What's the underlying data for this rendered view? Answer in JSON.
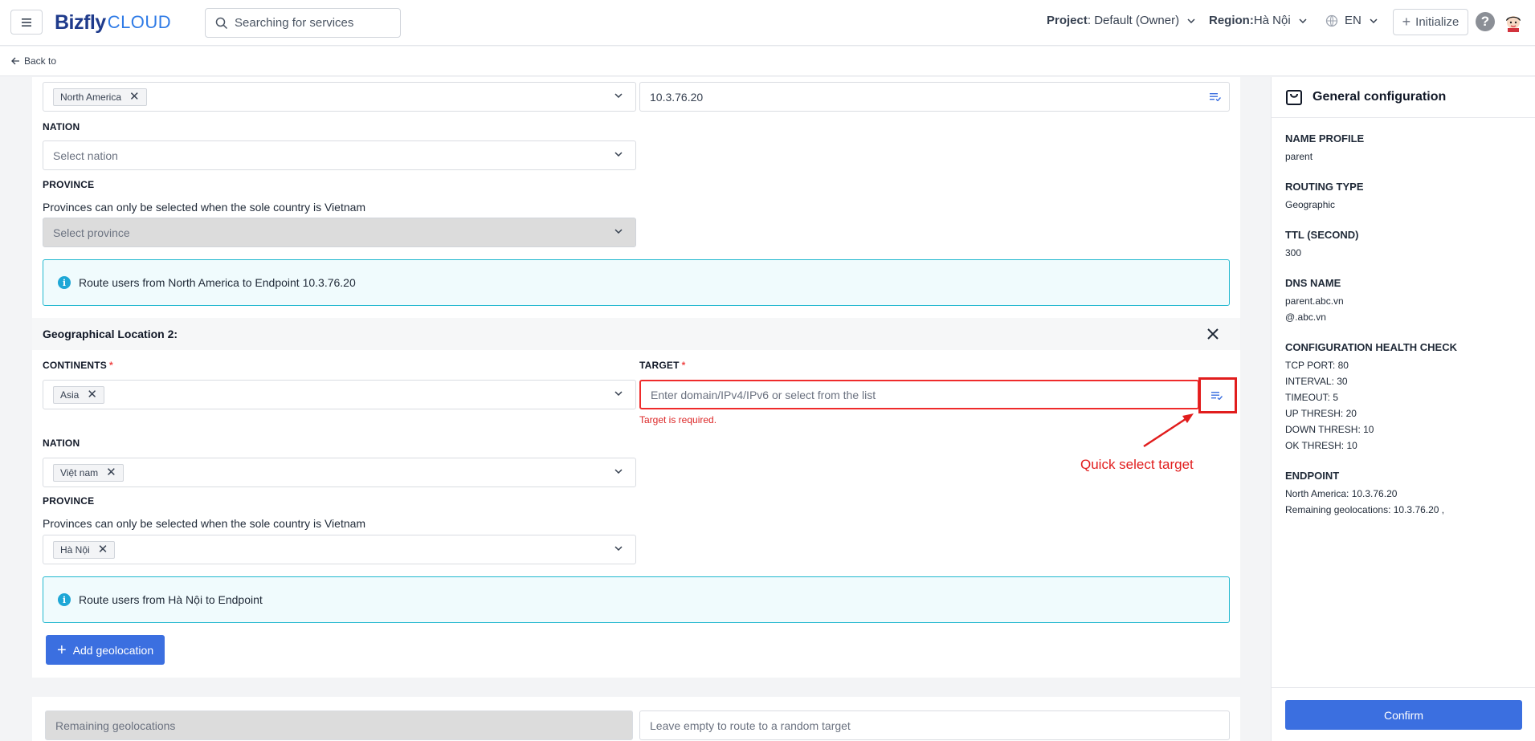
{
  "header": {
    "logo_main": "Bizfly",
    "logo_sub": "CLOUD",
    "search_placeholder": "Searching for services",
    "project_label": "Project",
    "project_value": " : Default (Owner)",
    "region_label": "Region:",
    "region_value": " Hà Nội",
    "language": "EN",
    "initialize_label": "Initialize",
    "help_label": "?"
  },
  "back_label": "Back to",
  "location1": {
    "continent_tag": "North America",
    "target_value": "10.3.76.20",
    "nation_label": "NATION",
    "nation_placeholder": "Select nation",
    "province_label": "PROVINCE",
    "province_help": "Provinces can only be selected when the sole country is Vietnam",
    "province_placeholder": "Select province",
    "info": "Route users from North America to Endpoint 10.3.76.20"
  },
  "location2": {
    "title": "Geographical Location 2:",
    "continents_label": "CONTINENTS",
    "required_mark": "*",
    "continent_tag": "Asia",
    "target_label": "TARGET",
    "target_placeholder": "Enter domain/IPv4/IPv6 or select from the list",
    "target_error": "Target is required.",
    "nation_label": "NATION",
    "nation_tag": "Việt nam",
    "province_label": "PROVINCE",
    "province_help": "Provinces can only be selected when the sole country is Vietnam",
    "province_tag": "Hà Nội",
    "info": "Route users from Hà Nội to Endpoint"
  },
  "annotation": "Quick select target",
  "add_geolocation_label": "Add geolocation",
  "remaining": {
    "label": "Remaining geolocations",
    "target_placeholder": "Leave empty to route to a random target"
  },
  "panel": {
    "title": "General configuration",
    "name_profile_label": "NAME PROFILE",
    "name_profile_value": "parent",
    "routing_type_label": "ROUTING TYPE",
    "routing_type_value": "Geographic",
    "ttl_label": "TTL (SECOND)",
    "ttl_value": "300",
    "dns_name_label": "DNS NAME",
    "dns_name_values": [
      "parent.abc.vn",
      "@.abc.vn"
    ],
    "health_check_label": "CONFIGURATION HEALTH CHECK",
    "health_check_values": [
      "TCP PORT: 80",
      "INTERVAL: 30",
      "TIMEOUT: 5",
      "UP THRESH: 20",
      "DOWN THRESH: 10",
      "OK THRESH: 10"
    ],
    "endpoint_label": "ENDPOINT",
    "endpoint_values": [
      "North America: 10.3.76.20",
      "Remaining geolocations: 10.3.76.20 ,"
    ],
    "confirm_label": "Confirm"
  },
  "colors": {
    "primary": "#3b6fe0",
    "error": "#e11d1d",
    "info_border": "#22b8cf"
  }
}
